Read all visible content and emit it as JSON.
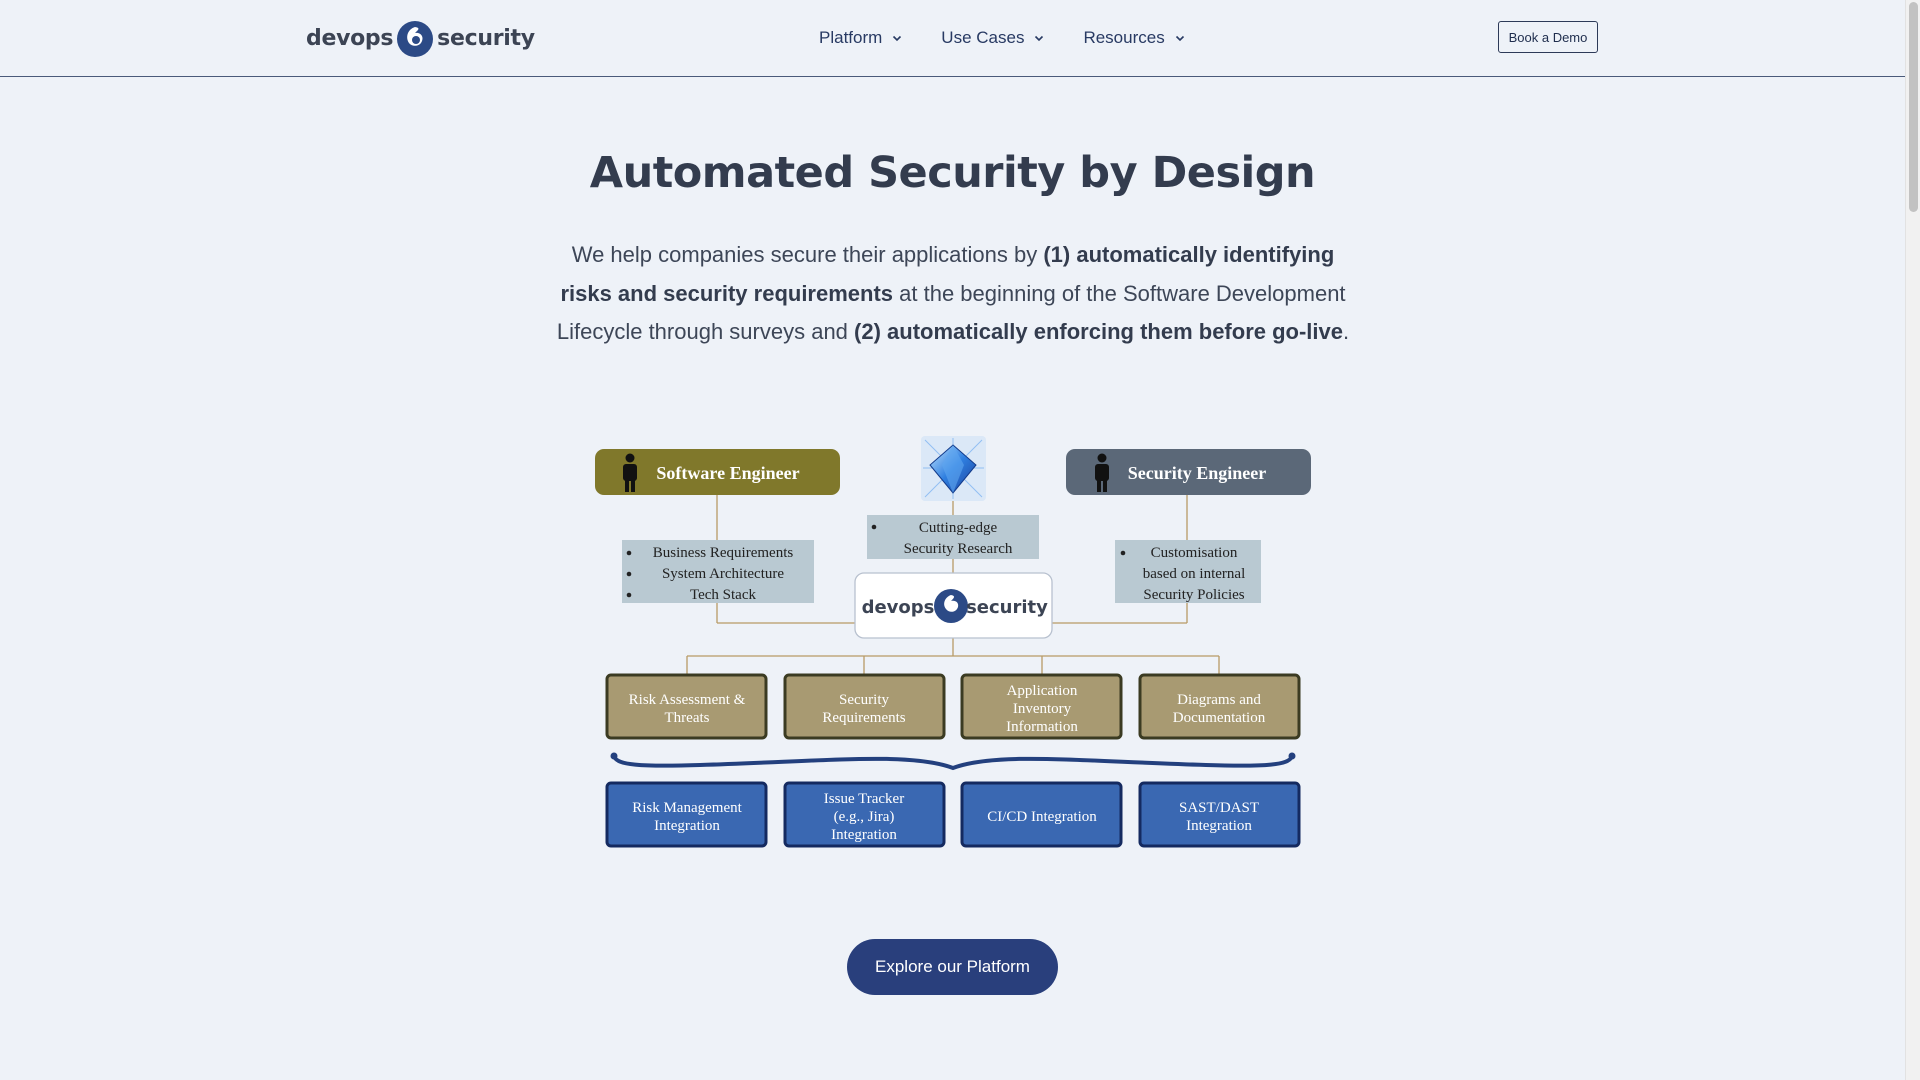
{
  "header": {
    "logo_left": "devops",
    "logo_right": "security",
    "nav": [
      {
        "label": "Platform",
        "icon": "chevron-down-icon"
      },
      {
        "label": "Use Cases",
        "icon": "chevron-down-icon"
      },
      {
        "label": "Resources",
        "icon": "chevron-down-icon"
      }
    ],
    "cta_label": "Book a Demo"
  },
  "hero": {
    "title": "Automated Security by Design",
    "desc": {
      "t1": "We help companies secure their applications by ",
      "b1": "(1) automatically identifying risks and security requirements",
      "t2": " at the beginning of the Software Development Lifecycle through surveys and ",
      "b2": "(2) automatically enforcing them before go-live",
      "t3": "."
    }
  },
  "diagram": {
    "software_engineer": "Software Engineer",
    "security_engineer": "Security Engineer",
    "software_inputs": [
      "Business Requirements",
      "System Architecture",
      "Tech Stack"
    ],
    "research": [
      "Cutting-edge",
      "Security Research"
    ],
    "security_inputs": [
      "Customisation",
      "based on internal",
      "Security Policies"
    ],
    "center_left": "devops",
    "center_right": "security",
    "outputs": [
      [
        "Risk Assessment &",
        "Threats"
      ],
      [
        "Security",
        "Requirements"
      ],
      [
        "Application",
        "Inventory",
        "Information"
      ],
      [
        "Diagrams and",
        "Documentation"
      ]
    ],
    "integrations": [
      [
        "Risk Management",
        "Integration"
      ],
      [
        "Issue Tracker",
        "(e.g., Jira)",
        "Integration"
      ],
      [
        "CI/CD Integration"
      ],
      [
        "SAST/DAST",
        "Integration"
      ]
    ],
    "colors": {
      "software_engineer": "#80782b",
      "security_engineer": "#5b6878",
      "output_box": "#a89a72",
      "integration_box": "#3a68b2",
      "brace": "#23407e",
      "input_box": "#b9c9d2"
    }
  },
  "cta": {
    "label": "Explore our Platform"
  }
}
